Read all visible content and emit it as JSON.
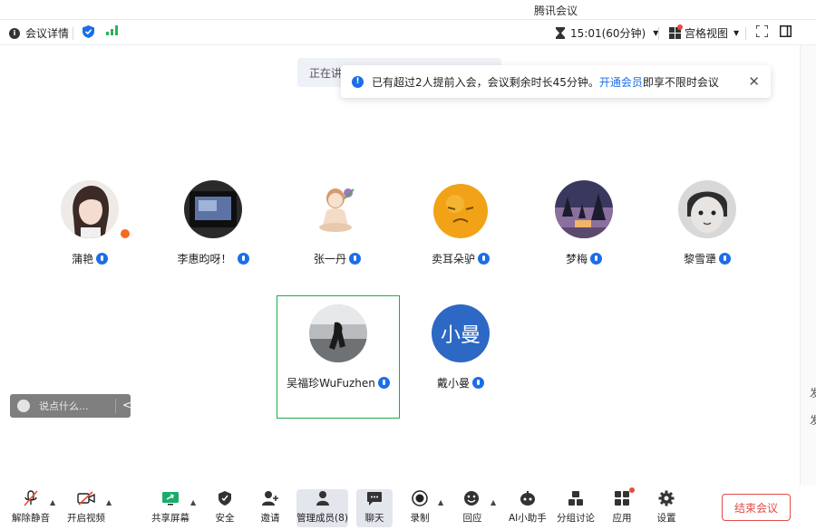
{
  "window": {
    "title": "腾讯会议"
  },
  "topbar": {
    "meeting_details": "会议详情",
    "timer": "15:01(60分钟)",
    "view_mode": "宫格视图"
  },
  "banner": {
    "speaking": "正在讲"
  },
  "notice": {
    "text": "已有超过2人提前入会，会议剩余时长45分钟。",
    "link": "开通会员",
    "tail": "即享不限时会议"
  },
  "participants": [
    {
      "name": "蒲艳",
      "host": true
    },
    {
      "name": "李惠昀呀！"
    },
    {
      "name": "张一丹"
    },
    {
      "name": "卖耳朵驴"
    },
    {
      "name": "梦梅"
    },
    {
      "name": "黎雪犟"
    },
    {
      "name": "吴福珍WuFuzhen",
      "selected": true
    },
    {
      "name": "戴小曼",
      "initials": "小曼"
    }
  ],
  "chat": {
    "placeholder": "说点什么..."
  },
  "toolbar": {
    "unmute": "解除静音",
    "start_video": "开启视频",
    "share_screen": "共享屏幕",
    "security": "安全",
    "invite": "邀请",
    "manage_members": "管理成员(8)",
    "chat": "聊天",
    "record": "录制",
    "reaction": "回应",
    "ai_assistant": "AI小助手",
    "breakout": "分组讨论",
    "apps": "应用",
    "settings": "设置",
    "end_meeting": "结束会议"
  },
  "right_strip": {
    "char1": "发",
    "char2": "发"
  },
  "colors": {
    "accent": "#1b6ee8",
    "end_red": "#e24a4a",
    "selected_border": "#1aad4c",
    "host_badge": "#f36b21"
  }
}
